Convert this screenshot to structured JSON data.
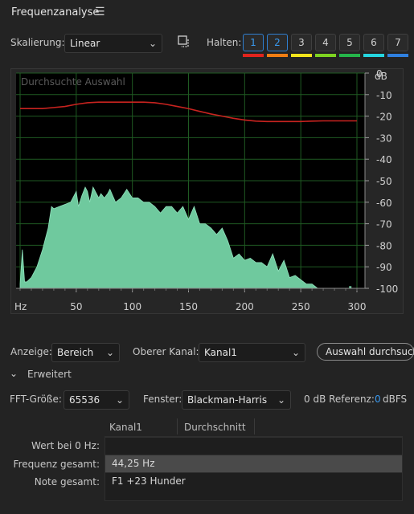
{
  "panel": {
    "title": "Frequenzanalyse",
    "menu_icon": "hamburger-icon"
  },
  "toolbar": {
    "scaling_label": "Skalierung:",
    "scaling_value": "Linear",
    "hold_label": "Halten:",
    "hold_buttons": [
      {
        "label": "1",
        "color": "#e0241d",
        "active": true
      },
      {
        "label": "2",
        "color": "#ef7d13",
        "active": true
      },
      {
        "label": "3",
        "color": "#f2e41b",
        "active": false
      },
      {
        "label": "4",
        "color": "#7ed320",
        "active": false
      },
      {
        "label": "5",
        "color": "#25b54a",
        "active": false
      },
      {
        "label": "6",
        "color": "#25d6e0",
        "active": false
      },
      {
        "label": "7",
        "color": "#2f80e0",
        "active": false
      }
    ]
  },
  "chart": {
    "overlay_title": "Durchsuchte Auswahl",
    "y_unit": "dB",
    "x_unit": "Hz",
    "y_ticks": [
      "0",
      "-10",
      "-20",
      "-30",
      "-40",
      "-50",
      "-60",
      "-70",
      "-80",
      "-90",
      "-100"
    ],
    "x_ticks": [
      "50",
      "100",
      "150",
      "200",
      "250",
      "300"
    ]
  },
  "chart_data": {
    "type": "area",
    "xlabel": "Hz",
    "ylabel": "dB",
    "xlim": [
      0,
      300
    ],
    "ylim": [
      -100,
      0
    ],
    "grid": true,
    "series": [
      {
        "color": "#c8231f",
        "kind": "line",
        "x": [
          0,
          10,
          20,
          30,
          40,
          50,
          60,
          70,
          80,
          90,
          100,
          110,
          120,
          130,
          140,
          150,
          160,
          170,
          180,
          190,
          200,
          210,
          220,
          230,
          240,
          250,
          260,
          270,
          280,
          290,
          300
        ],
        "y": [
          -16.5,
          -16.5,
          -16.5,
          -16,
          -15.5,
          -14.5,
          -13.8,
          -13.5,
          -13.5,
          -13.5,
          -13.5,
          -13.5,
          -13.8,
          -14.5,
          -15.5,
          -16.5,
          -17.8,
          -19,
          -20,
          -21,
          -21.8,
          -22.3,
          -22.5,
          -22.5,
          -22.5,
          -22.5,
          -22.3,
          -22.2,
          -22.2,
          -22.2,
          -22.2
        ]
      },
      {
        "color": "#6fc99e",
        "kind": "area",
        "x": [
          0,
          2,
          4,
          6,
          8,
          10,
          15,
          20,
          25,
          28,
          30,
          35,
          40,
          45,
          50,
          52,
          55,
          58,
          60,
          62,
          65,
          68,
          70,
          72,
          75,
          78,
          80,
          85,
          90,
          95,
          100,
          105,
          110,
          115,
          120,
          125,
          130,
          135,
          140,
          145,
          150,
          155,
          160,
          165,
          170,
          175,
          180,
          185,
          190,
          195,
          200,
          205,
          210,
          215,
          220,
          225,
          230,
          235,
          240,
          245,
          250,
          255,
          260,
          265
        ],
        "y": [
          -98,
          -82,
          -97,
          -97,
          -96,
          -95,
          -90,
          -82,
          -72,
          -62,
          -63,
          -62,
          -61,
          -60,
          -55,
          -62,
          -57,
          -53,
          -55,
          -60,
          -53,
          -56,
          -58,
          -56,
          -58,
          -56,
          -54,
          -60,
          -58,
          -54,
          -58,
          -58,
          -60,
          -60,
          -62,
          -65,
          -62,
          -62,
          -65,
          -62,
          -68,
          -62,
          -70,
          -70,
          -72,
          -75,
          -72,
          -78,
          -86,
          -84,
          -87,
          -86,
          -88,
          -88,
          -90,
          -84,
          -92,
          -87,
          -95,
          -94,
          -96,
          -98,
          -98,
          -100
        ]
      }
    ]
  },
  "controls": {
    "display_label": "Anzeige:",
    "display_value": "Bereich",
    "upper_channel_label": "Oberer Kanal:",
    "upper_channel_value": "Kanal1",
    "scan_button": "Auswahl durchsuchen"
  },
  "advanced": {
    "section_label": "Erweitert",
    "fft_label": "FFT-Größe:",
    "fft_value": "65536",
    "window_label": "Fenster:",
    "window_value": "Blackman-Harris",
    "ref_label": "0 dB Referenz:",
    "ref_value": "0",
    "ref_unit": "dBFS"
  },
  "table": {
    "col1": "Kanal1",
    "col2": "Durchschnitt",
    "rows": [
      {
        "label": "Wert bei 0 Hz:",
        "value": ""
      },
      {
        "label": "Frequenz gesamt:",
        "value": "44,25 Hz"
      },
      {
        "label": "Note gesamt:",
        "value": "F1 +23 Hunder"
      }
    ]
  }
}
